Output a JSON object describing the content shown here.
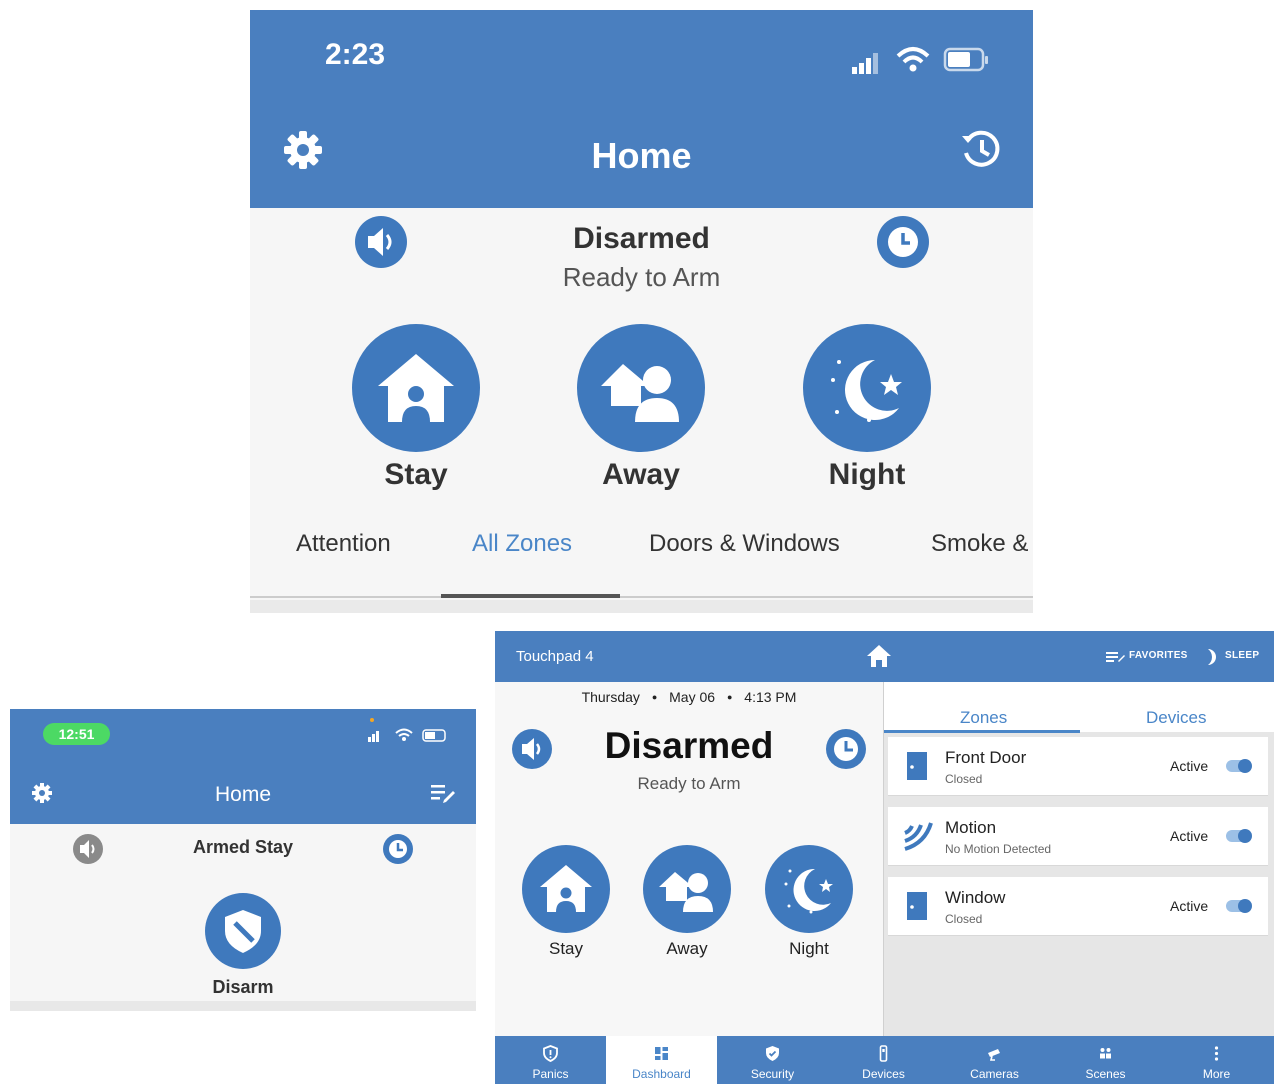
{
  "phone_large": {
    "status_time": "2:23",
    "title": "Home",
    "state": "Disarmed",
    "substate": "Ready to Arm",
    "arm_buttons": [
      {
        "label": "Stay",
        "icon": "house-person-icon"
      },
      {
        "label": "Away",
        "icon": "person-leaving-icon"
      },
      {
        "label": "Night",
        "icon": "moon-stars-icon"
      }
    ],
    "tabs": [
      "Attention",
      "All Zones",
      "Doors & Windows",
      "Smoke &"
    ],
    "active_tab": "All Zones",
    "icons": [
      "settings-icon",
      "history-icon",
      "chime-icon",
      "clock-icon",
      "signal-icon",
      "wifi-icon",
      "battery-icon"
    ]
  },
  "phone_small": {
    "status_time": "12:51",
    "title": "Home",
    "state": "Armed Stay",
    "disarm_label": "Disarm",
    "icons": [
      "settings-icon",
      "edit-list-icon",
      "chime-icon",
      "clock-icon",
      "shield-icon"
    ]
  },
  "touchpad": {
    "title": "Touchpad 4",
    "favorites_label": "FAVORITES",
    "sleep_label": "SLEEP",
    "date_day": "Thursday",
    "date_date": "May 06",
    "date_time": "4:13 PM",
    "state": "Disarmed",
    "substate": "Ready to Arm",
    "arm_buttons": [
      {
        "label": "Stay"
      },
      {
        "label": "Away"
      },
      {
        "label": "Night"
      }
    ],
    "tabs": [
      "Zones",
      "Devices"
    ],
    "active_tab": "Zones",
    "zones": [
      {
        "name": "Front Door",
        "status": "Closed",
        "state": "Active",
        "toggle_on": true,
        "icon": "door-icon"
      },
      {
        "name": "Motion",
        "status": "No Motion Detected",
        "state": "Active",
        "toggle_on": true,
        "icon": "motion-icon"
      },
      {
        "name": "Window",
        "status": "Closed",
        "state": "Active",
        "toggle_on": true,
        "icon": "window-icon"
      }
    ],
    "bottom_nav": [
      {
        "label": "Panics",
        "icon": "panic-shield-icon"
      },
      {
        "label": "Dashboard",
        "icon": "dashboard-icon"
      },
      {
        "label": "Security",
        "icon": "security-icon"
      },
      {
        "label": "Devices",
        "icon": "devices-icon"
      },
      {
        "label": "Cameras",
        "icon": "camera-icon"
      },
      {
        "label": "Scenes",
        "icon": "scenes-icon"
      },
      {
        "label": "More",
        "icon": "more-icon"
      }
    ],
    "active_nav": "Dashboard",
    "colors": {
      "brand": "#4a7fbf",
      "button": "#3f79bd",
      "accent_text": "#4a86c8"
    }
  }
}
